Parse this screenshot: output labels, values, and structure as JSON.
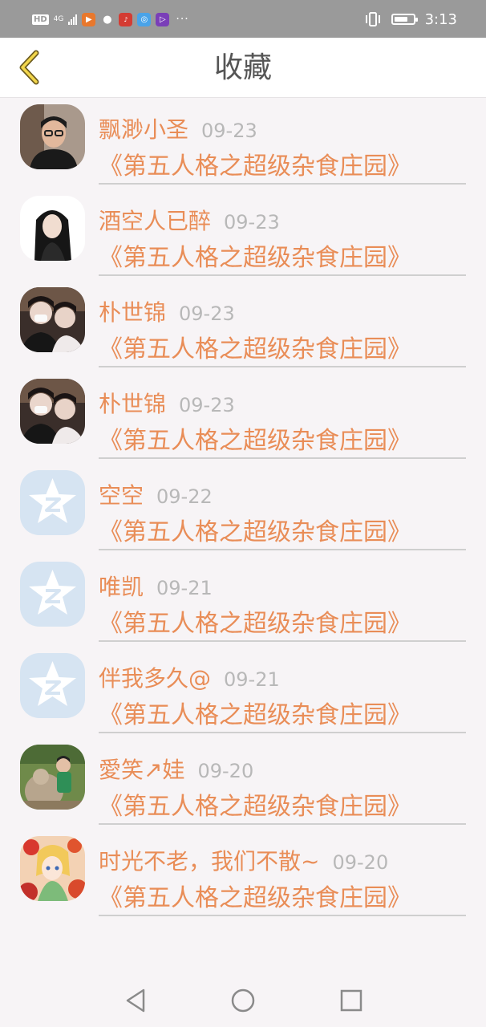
{
  "status_bar": {
    "hd_label": "HD",
    "network_label": "4G",
    "time": "3:13",
    "battery_level": 0.75,
    "app_icons": [
      "video-app-icon",
      "wechat-icon",
      "netease-music-icon",
      "browser-icon",
      "media-player-icon"
    ]
  },
  "header": {
    "title": "收藏",
    "back_icon": "chevron-left-icon"
  },
  "items": [
    {
      "name": "飘渺小圣",
      "date": "09-23",
      "work": "《第五人格之超级杂食庄园》",
      "avatar": "photo-man-glasses"
    },
    {
      "name": "酒空人已醉",
      "date": "09-23",
      "work": "《第五人格之超级杂食庄园》",
      "avatar": "photo-woman-long-hair"
    },
    {
      "name": "朴世锦",
      "date": "09-23",
      "work": "《第五人格之超级杂食庄园》",
      "avatar": "photo-girls-masks"
    },
    {
      "name": "朴世锦",
      "date": "09-23",
      "work": "《第五人格之超级杂食庄园》",
      "avatar": "photo-girls-masks"
    },
    {
      "name": "空空",
      "date": "09-22",
      "work": "《第五人格之超级杂食庄园》",
      "avatar": "default-star-avatar"
    },
    {
      "name": "唯凯",
      "date": "09-21",
      "work": "《第五人格之超级杂食庄园》",
      "avatar": "default-star-avatar"
    },
    {
      "name": "伴我多久@",
      "date": "09-21",
      "work": "《第五人格之超级杂食庄园》",
      "avatar": "default-star-avatar"
    },
    {
      "name": "愛笑↗娃",
      "date": "09-20",
      "work": "《第五人格之超级杂食庄园》",
      "avatar": "photo-outdoor-statue"
    },
    {
      "name": "时光不老，我们不散~",
      "date": "09-20",
      "work": "《第五人格之超级杂食庄园》",
      "avatar": "anime-illustration"
    }
  ],
  "nav_bar": {
    "back_icon": "triangle-back-icon",
    "home_icon": "circle-home-icon",
    "recents_icon": "square-recents-icon"
  },
  "colors": {
    "accent": "#e98d57",
    "date": "#b8b8b8",
    "status_bar_bg": "#9a9a9a",
    "divider": "#cfcfcf"
  }
}
